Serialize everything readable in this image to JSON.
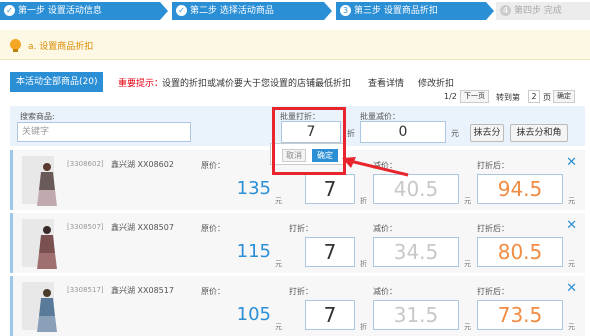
{
  "steps": [
    {
      "num": "✓",
      "label": "第一步 设置活动信息"
    },
    {
      "num": "✓",
      "label": "第二步 选择活动商品"
    },
    {
      "num": "3",
      "label": "第三步 设置商品折扣"
    },
    {
      "num": "4",
      "label": "第四步 完成"
    }
  ],
  "section_title": "a. 设置商品折扣",
  "tab_label": "本活动全部商品(20)",
  "warning_label": "重要提示：",
  "warning_text": "设置的折扣或减价要大于您设置的店铺最低折扣",
  "link_view": "查看详情",
  "link_edit": "修改折扣",
  "pager": {
    "page_info": "1/2",
    "next": "下一页",
    "goto": "转到第",
    "page_value": "2",
    "page_unit": "页",
    "confirm": "确定"
  },
  "filter": {
    "search_label": "搜索商品:",
    "search_placeholder": "关键字",
    "batch_discount_label": "批量打折：",
    "batch_discount_value": "7",
    "batch_discount_unit": "折",
    "batch_reduce_label": "批量减价：",
    "batch_reduce_value": "0",
    "batch_reduce_unit": "元",
    "erase_cents": "抹去分",
    "erase_cents_jiao": "抹去分和角"
  },
  "popup": {
    "cancel": "取消",
    "ok": "确定"
  },
  "labels": {
    "orig": "原价：",
    "discount": "打折：",
    "reduce": "减价：",
    "after": "打折后："
  },
  "units": {
    "yuan": "元",
    "zhe": "折"
  },
  "products": [
    {
      "code": "[3308602]",
      "name": "鑫兴湖 XX08602",
      "orig": "135",
      "discount": "7",
      "reduce": "40.5",
      "final": "94.5"
    },
    {
      "code": "[3308507]",
      "name": "鑫兴湖 XX08507",
      "orig": "115",
      "discount": "7",
      "reduce": "34.5",
      "final": "80.5"
    },
    {
      "code": "[3308517]",
      "name": "鑫兴湖 XX08517",
      "orig": "105",
      "discount": "7",
      "reduce": "31.5",
      "final": "73.5"
    }
  ],
  "colors": {
    "accent": "#2b8fd6",
    "warning": "#e60012",
    "highlight": "#e8242c",
    "final": "#f08c43"
  }
}
